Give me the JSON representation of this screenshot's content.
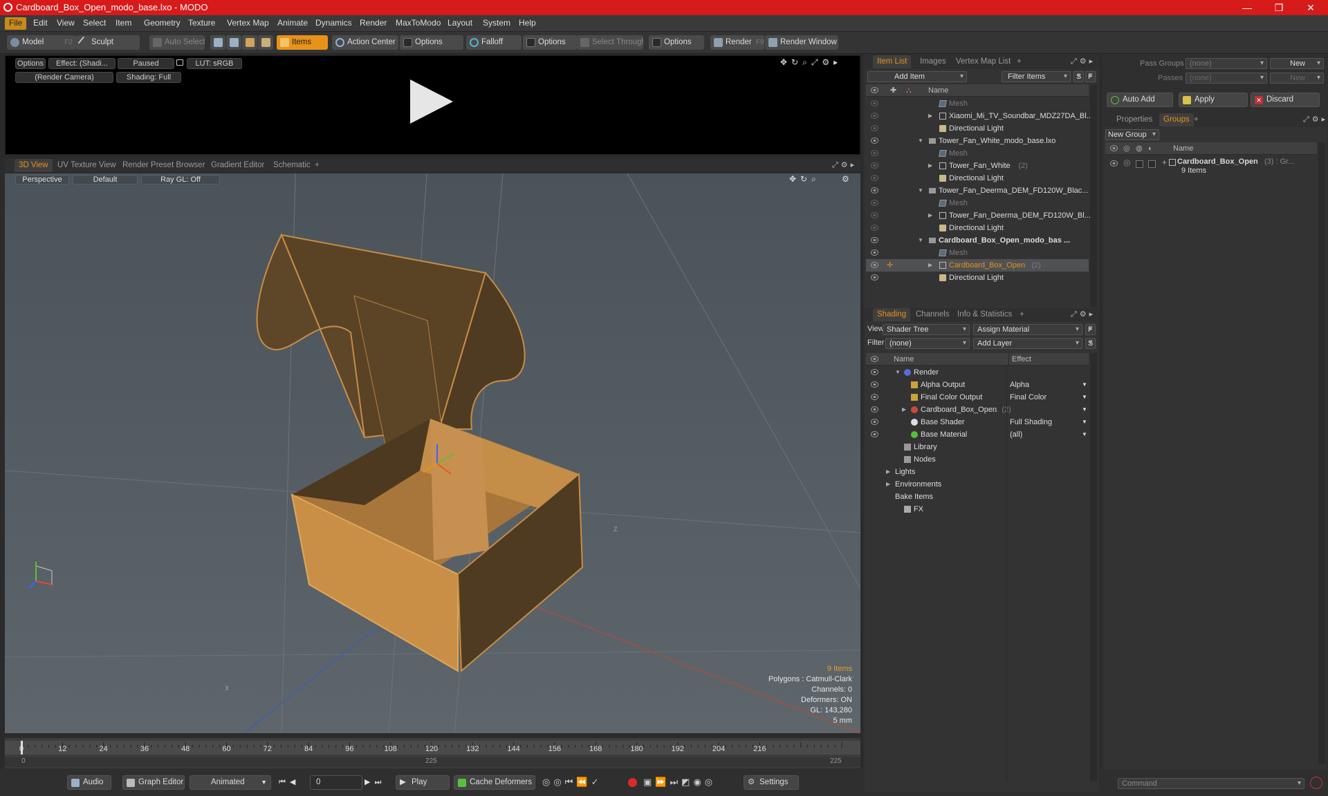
{
  "titlebar": {
    "title": "Cardboard_Box_Open_modo_base.lxo - MODO",
    "minimize": "—",
    "maximize": "❐",
    "close": "✕"
  },
  "menu": [
    "File",
    "Edit",
    "View",
    "Select",
    "Item",
    "Geometry",
    "Texture",
    "Vertex Map",
    "Animate",
    "Dynamics",
    "Render",
    "MaxToModo",
    "Layout",
    "System",
    "Help"
  ],
  "toolbar": {
    "model": "Model",
    "model_key": "F2",
    "sculpt": "Sculpt",
    "auto_select": "Auto Select",
    "items": "Items",
    "action_center": "Action Center",
    "options1": "Options",
    "falloff": "Falloff",
    "options2": "Options",
    "select_through": "Select Through",
    "options3": "Options",
    "render": "Render",
    "render_key": "F9",
    "render_window": "Render Window"
  },
  "preview": {
    "options": "Options",
    "effect": "Effect: (Shadi...",
    "paused": "Paused",
    "lut": "LUT: sRGB",
    "camera": "(Render Camera)",
    "shading": "Shading: Full"
  },
  "viewtabs": [
    "3D View",
    "UV Texture View",
    "Render Preset Browser",
    "Gradient Editor",
    "Schematic",
    "+"
  ],
  "viewport": {
    "perspective": "Perspective",
    "default": "Default",
    "raygl": "Ray GL: Off",
    "axis_z": "Z",
    "axis_x": "X"
  },
  "stats": {
    "items": "9 Items",
    "polygons": "Polygons : Catmull-Clark",
    "channels": "Channels: 0",
    "deformers": "Deformers: ON",
    "gl": "GL: 143,280",
    "unit": "5 mm"
  },
  "timeline": {
    "ticks": [
      "0",
      "12",
      "24",
      "36",
      "48",
      "60",
      "72",
      "84",
      "96",
      "108",
      "120",
      "132",
      "144",
      "156",
      "168",
      "180",
      "192",
      "204",
      "216"
    ],
    "start": "0",
    "mid": "225",
    "end": "225"
  },
  "bottombar": {
    "audio": "Audio",
    "graph_editor": "Graph Editor",
    "animated": "Animated",
    "frame": "0",
    "play": "Play",
    "cache_deformers": "Cache Deformers",
    "settings": "Settings"
  },
  "itemlist": {
    "tabs": [
      "Item List",
      "Images",
      "Vertex Map List",
      "+"
    ],
    "add_item": "Add Item",
    "filter_items": "Filter Items",
    "s": "S",
    "f": "F",
    "col_name": "Name",
    "rows": [
      {
        "label": "Mesh",
        "indent": 2,
        "icon": "mesh",
        "dim": true,
        "eye": "dim"
      },
      {
        "label": "Xiaomi_Mi_TV_Soundbar_MDZ27DA_Bl...",
        "indent": 2,
        "icon": "loc",
        "arrow": "▶",
        "eye": "dim"
      },
      {
        "label": "Directional Light",
        "indent": 2,
        "icon": "light",
        "eye": "dim"
      },
      {
        "label": "Tower_Fan_White_modo_base.lxo",
        "indent": 1,
        "icon": "scene",
        "arrow": "▼"
      },
      {
        "label": "Mesh",
        "indent": 2,
        "icon": "mesh",
        "dim": true,
        "eye": "dim"
      },
      {
        "label": "Tower_Fan_White",
        "count": "(2)",
        "indent": 2,
        "icon": "loc",
        "arrow": "▶",
        "eye": "dim"
      },
      {
        "label": "Directional Light",
        "indent": 2,
        "icon": "light",
        "eye": "dim"
      },
      {
        "label": "Tower_Fan_Deerma_DEM_FD120W_Blac...",
        "indent": 1,
        "icon": "scene",
        "arrow": "▼"
      },
      {
        "label": "Mesh",
        "indent": 2,
        "icon": "mesh",
        "dim": true,
        "eye": "dim"
      },
      {
        "label": "Tower_Fan_Deerma_DEM_FD120W_Bl...",
        "indent": 2,
        "icon": "loc",
        "arrow": "▶",
        "eye": "dim"
      },
      {
        "label": "Directional Light",
        "indent": 2,
        "icon": "light",
        "eye": "dim"
      },
      {
        "label": "Cardboard_Box_Open_modo_bas ...",
        "indent": 1,
        "icon": "scene",
        "arrow": "▼",
        "bold": true
      },
      {
        "label": "Mesh",
        "indent": 2,
        "icon": "mesh",
        "dim": true
      },
      {
        "label": "Cardboard_Box_Open",
        "count": "(2)",
        "indent": 2,
        "icon": "loc",
        "arrow": "▶",
        "selected": true
      },
      {
        "label": "Directional Light",
        "indent": 2,
        "icon": "light"
      }
    ]
  },
  "shading": {
    "tabs": [
      "Shading",
      "Channels",
      "Info & Statistics",
      "+"
    ],
    "view_label": "View",
    "view_value": "Shader Tree",
    "assign_material": "Assign Material",
    "filter_label": "Filter",
    "filter_value": "(none)",
    "add_layer": "Add Layer",
    "f": "F",
    "s": "S",
    "col_name": "Name",
    "col_effect": "Effect",
    "rows": [
      {
        "label": "Render",
        "indent": 1,
        "arrow": "▼",
        "icon": "render",
        "eye": true
      },
      {
        "label": "Alpha Output",
        "indent": 2,
        "icon": "output",
        "effect": "Alpha",
        "eye": true
      },
      {
        "label": "Final Color Output",
        "indent": 2,
        "icon": "output",
        "effect": "Final Color",
        "eye": true
      },
      {
        "label": "Cardboard_Box_Open",
        "count": "(2)",
        "suffix": "...",
        "indent": 2,
        "arrow": "▶",
        "icon": "mat",
        "effect": "",
        "eye": true
      },
      {
        "label": "Base Shader",
        "indent": 2,
        "icon": "shader",
        "effect": "Full Shading",
        "eye": true
      },
      {
        "label": "Base Material",
        "indent": 2,
        "icon": "basemat",
        "effect": "(all)",
        "eye": true
      },
      {
        "label": "Library",
        "indent": 1,
        "icon": "folder"
      },
      {
        "label": "Nodes",
        "indent": 1,
        "icon": "folder"
      },
      {
        "label": "Lights",
        "indent": 0,
        "arrow": "▶"
      },
      {
        "label": "Environments",
        "indent": 0,
        "arrow": "▶"
      },
      {
        "label": "Bake Items",
        "indent": 0
      },
      {
        "label": "FX",
        "indent": 1,
        "icon": "fx"
      }
    ]
  },
  "passes": {
    "pass_groups": "Pass Groups",
    "passes": "Passes",
    "none1": "(none)",
    "none2": "(none)",
    "new1": "New",
    "new2": "New",
    "auto_add": "Auto Add",
    "apply": "Apply",
    "discard": "Discard"
  },
  "groups": {
    "tabs": [
      "Properties",
      "Groups",
      "+"
    ],
    "new_group": "New Group",
    "col_name": "Name",
    "group_name": "Cardboard_Box_Open",
    "group_count": "(3) : Gr...",
    "group_items": "9 Items"
  },
  "command": {
    "placeholder": "Command"
  }
}
